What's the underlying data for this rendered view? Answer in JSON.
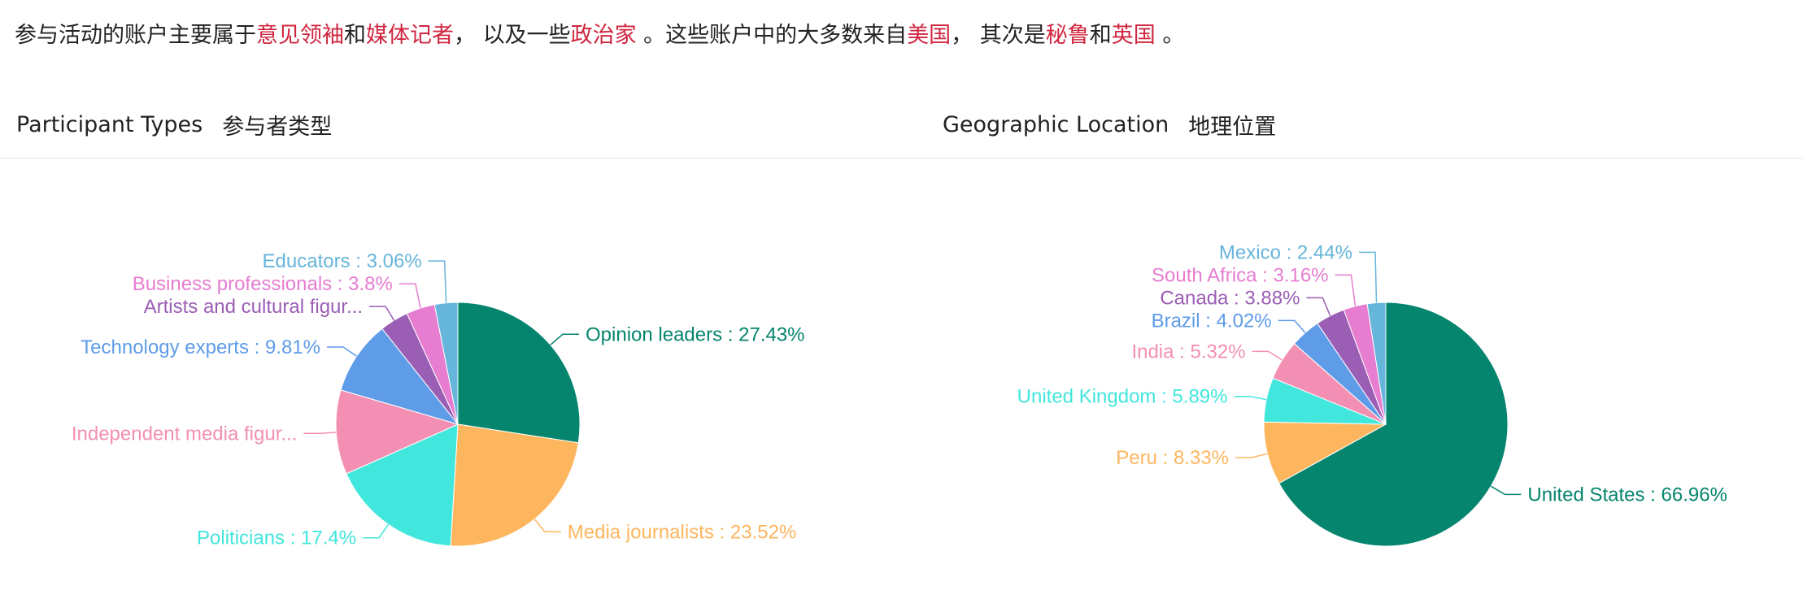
{
  "summary": {
    "p1": "参与活动的账户主要属于",
    "h1": "意见领袖",
    "p2": "和",
    "h2": "媒体记者",
    "p3": "， 以及一些",
    "h3": "政治家",
    "p4": " 。这些账户中的大多数来自",
    "h4": "美国",
    "p5": "， 其次是",
    "h5": "秘鲁",
    "p6": "和",
    "h6": "英国",
    "p7": " 。"
  },
  "panels": {
    "left": {
      "title_en": "Participant Types",
      "title_cn": "参与者类型"
    },
    "right": {
      "title_en": "Geographic Location",
      "title_cn": "地理位置"
    }
  },
  "chart_data": [
    {
      "type": "pie",
      "title": "Participant Types 参与者类型",
      "slices": [
        {
          "label": "Opinion leaders",
          "display": "Opinion leaders : 27.43%",
          "value": 27.43,
          "color": "#06856e"
        },
        {
          "label": "Media journalists",
          "display": "Media journalists : 23.52%",
          "value": 23.52,
          "color": "#fdb65e"
        },
        {
          "label": "Politicians",
          "display": "Politicians : 17.4%",
          "value": 17.4,
          "color": "#41e6dc"
        },
        {
          "label": "Independent media figures",
          "display": "Independent media figur...",
          "value": 11.18,
          "color": "#f38fb3"
        },
        {
          "label": "Technology experts",
          "display": "Technology experts : 9.81%",
          "value": 9.81,
          "color": "#5e9ce8"
        },
        {
          "label": "Artists and cultural figures",
          "display": "Artists and cultural figur...",
          "value": 3.8,
          "color": "#9b5eb5"
        },
        {
          "label": "Business professionals",
          "display": "Business professionals : 3.8%",
          "value": 3.8,
          "color": "#e67dd0"
        },
        {
          "label": "Educators",
          "display": "Educators : 3.06%",
          "value": 3.06,
          "color": "#66b5db"
        }
      ]
    },
    {
      "type": "pie",
      "title": "Geographic Location 地理位置",
      "slices": [
        {
          "label": "United States",
          "display": "United States : 66.96%",
          "value": 66.96,
          "color": "#06856e"
        },
        {
          "label": "Peru",
          "display": "Peru : 8.33%",
          "value": 8.33,
          "color": "#fdb65e"
        },
        {
          "label": "United Kingdom",
          "display": "United Kingdom : 5.89%",
          "value": 5.89,
          "color": "#41e6dc"
        },
        {
          "label": "India",
          "display": "India : 5.32%",
          "value": 5.32,
          "color": "#f38fb3"
        },
        {
          "label": "Brazil",
          "display": "Brazil : 4.02%",
          "value": 4.02,
          "color": "#5e9ce8"
        },
        {
          "label": "Canada",
          "display": "Canada : 3.88%",
          "value": 3.88,
          "color": "#9b5eb5"
        },
        {
          "label": "South Africa",
          "display": "South Africa : 3.16%",
          "value": 3.16,
          "color": "#e67dd0"
        },
        {
          "label": "Mexico",
          "display": "Mexico : 2.44%",
          "value": 2.44,
          "color": "#66b5db"
        }
      ]
    }
  ]
}
